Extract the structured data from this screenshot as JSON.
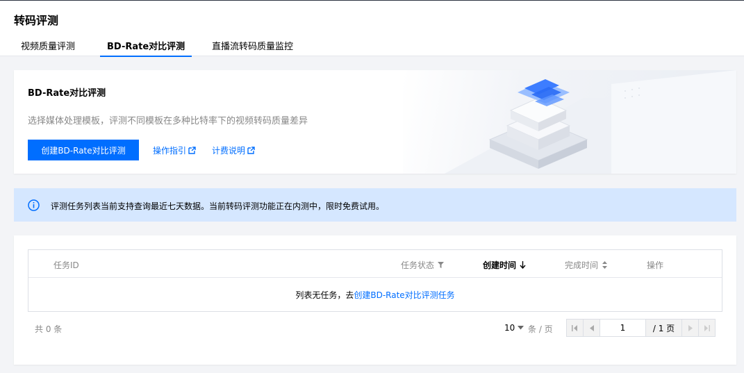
{
  "page": {
    "title": "转码评测"
  },
  "tabs": [
    {
      "label": "视频质量评测"
    },
    {
      "label": "BD-Rate对比评测"
    },
    {
      "label": "直播流转码质量监控"
    }
  ],
  "banner": {
    "title": "BD-Rate对比评测",
    "description": "选择媒体处理模板，评测不同模板在多种比特率下的视频转码质量差异",
    "create_button": "创建BD-Rate对比评测",
    "guide_link": "操作指引",
    "billing_link": "计费说明"
  },
  "notice": {
    "text": "评测任务列表当前支持查询最近七天数据。当前转码评测功能正在内测中，限时免费试用。"
  },
  "table": {
    "columns": [
      "任务ID",
      "任务状态",
      "创建时间",
      "完成时间",
      "操作"
    ],
    "empty_text": "列表无任务，去",
    "empty_link": "创建BD-Rate对比评测任务"
  },
  "pagination": {
    "total": "共 0 条",
    "page_size": "10",
    "per_page": "条 / 页",
    "current_page": "1",
    "total_pages": "/ 1 页"
  },
  "colors": {
    "accent": "#006eff",
    "notice_bg": "#d5e7ff"
  },
  "icons": [
    "external-link-icon",
    "info-icon",
    "filter-icon",
    "sort-down-icon",
    "sort-icon",
    "caret-down-icon",
    "first-page-icon",
    "prev-page-icon",
    "next-page-icon",
    "last-page-icon"
  ]
}
